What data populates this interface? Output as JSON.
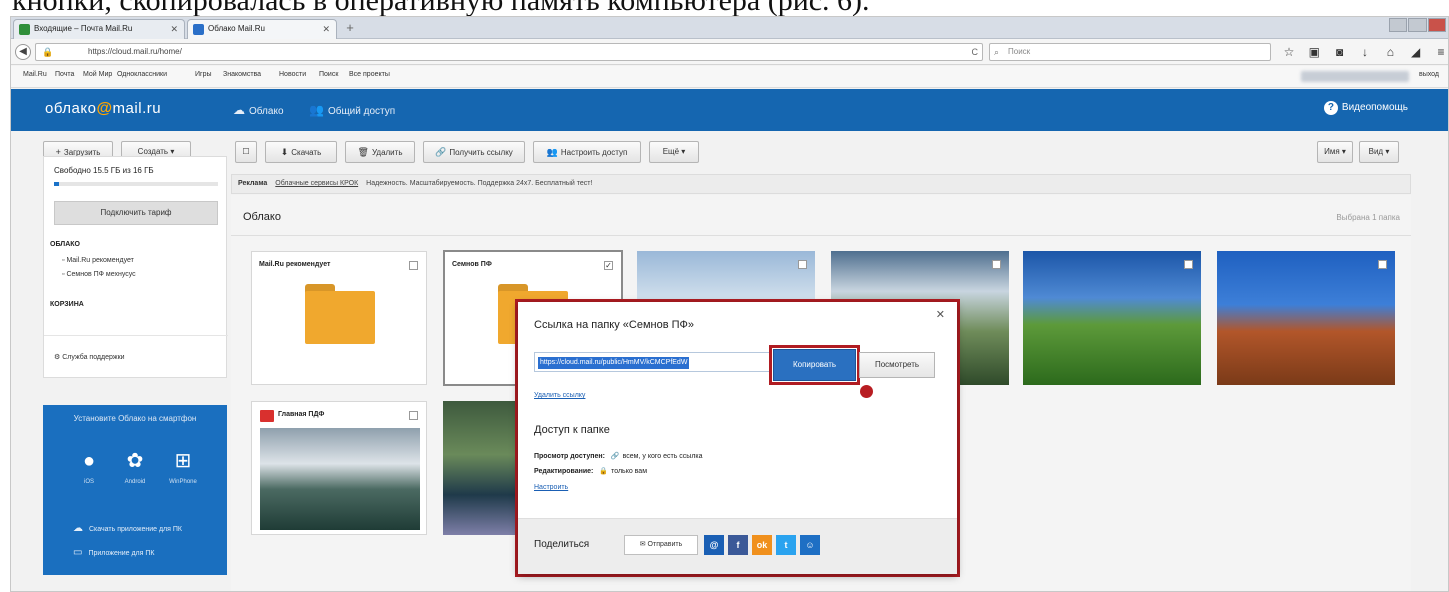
{
  "doc_caption": "кнопки, скопировалась в оперативную память компьютера (рис. 6).",
  "browser": {
    "tabs": [
      {
        "label": "Входящие – Почта Mail.Ru",
        "color": "#2f8f3a"
      },
      {
        "label": "Облако Mail.Ru",
        "color": "#2a6fc8"
      }
    ],
    "url": "https://cloud.mail.ru/home/",
    "search_placeholder": "Поиск",
    "bookmarks": [
      "Mail.Ru",
      "Почта",
      "Мой Мир",
      "Одноклассники",
      "Игры",
      "Знакомства",
      "Новости",
      "Поиск",
      "Все проекты"
    ],
    "bookmark_right": "выход"
  },
  "header": {
    "logo_text_a": "облако",
    "logo_at": "@",
    "logo_text_b": "mail",
    "logo_text_c": ".ru",
    "nav": [
      {
        "icon": "☁",
        "label": "Облако"
      },
      {
        "icon": "👥",
        "label": "Общий доступ"
      }
    ],
    "help": "Видеопомощь"
  },
  "toolbar": {
    "upload": "Загрузить",
    "create": "Создать",
    "download": "Скачать",
    "delete": "Удалить",
    "get_link": "Получить ссылку",
    "configure_access": "Настроить доступ",
    "more": "Ещё",
    "sort": "Имя",
    "view": "Вид"
  },
  "sidebar": {
    "quota": "Свободно 15.5 ГБ из 16 ГБ",
    "quota_used_fraction": 0.03,
    "upgrade": "Подключить тариф",
    "section_cloud": "ОБЛАКО",
    "items": [
      "Mail.Ru рекомендует",
      "Семнов ПФ мехнусус"
    ],
    "section_trash": "КОРЗИНА",
    "support": "Служба поддержки"
  },
  "promo": {
    "title": "Установите Облако на смартфон",
    "platforms": [
      {
        "glyph": "",
        "label": "iOS"
      },
      {
        "glyph": "🤖",
        "label": "Android"
      },
      {
        "glyph": "⊞",
        "label": "WinPhone"
      }
    ],
    "links": [
      "Скачать приложение для ПК",
      "Приложение для ПК"
    ]
  },
  "content": {
    "ad_label": "Реклама",
    "ad_link": "Облачные сервисы КРОК",
    "ad_text": "Надежность. Масштабируемость. Поддержка 24х7. Бесплатный тест!",
    "title": "Облако",
    "selected_count": "Выбрана 1 папка",
    "folders": [
      {
        "label": "Mail.Ru рекомендует",
        "checked": false
      },
      {
        "label": "Семнов ПФ",
        "checked": true
      }
    ],
    "file_label": "Главная ПДФ"
  },
  "dialog": {
    "title": "Ссылка на папку «Семнов ПФ»",
    "link_value": "https://cloud.mail.ru/public/HmMV/kCMCPfEdW",
    "copy": "Копировать",
    "view": "Посмотреть",
    "delete_link": "Удалить ссылку",
    "access_title": "Доступ к папке",
    "view_access_label": "Просмотр доступен:",
    "view_access_value": "всем, у кого есть ссылка",
    "edit_access_label": "Редактирование:",
    "edit_access_value": "только вам",
    "configure": "Настроить",
    "share_label": "Поделиться",
    "send": "Отправить",
    "socials": [
      {
        "name": "mail-ru",
        "glyph": "@",
        "color": "#1a5fb4"
      },
      {
        "name": "facebook",
        "glyph": "f",
        "color": "#3b5998"
      },
      {
        "name": "odnoklassniki",
        "glyph": "ok",
        "color": "#f0901d"
      },
      {
        "name": "twitter",
        "glyph": "t",
        "color": "#2aa3ef"
      },
      {
        "name": "moi-mir",
        "glyph": "☺",
        "color": "#1e6fc4"
      }
    ]
  }
}
